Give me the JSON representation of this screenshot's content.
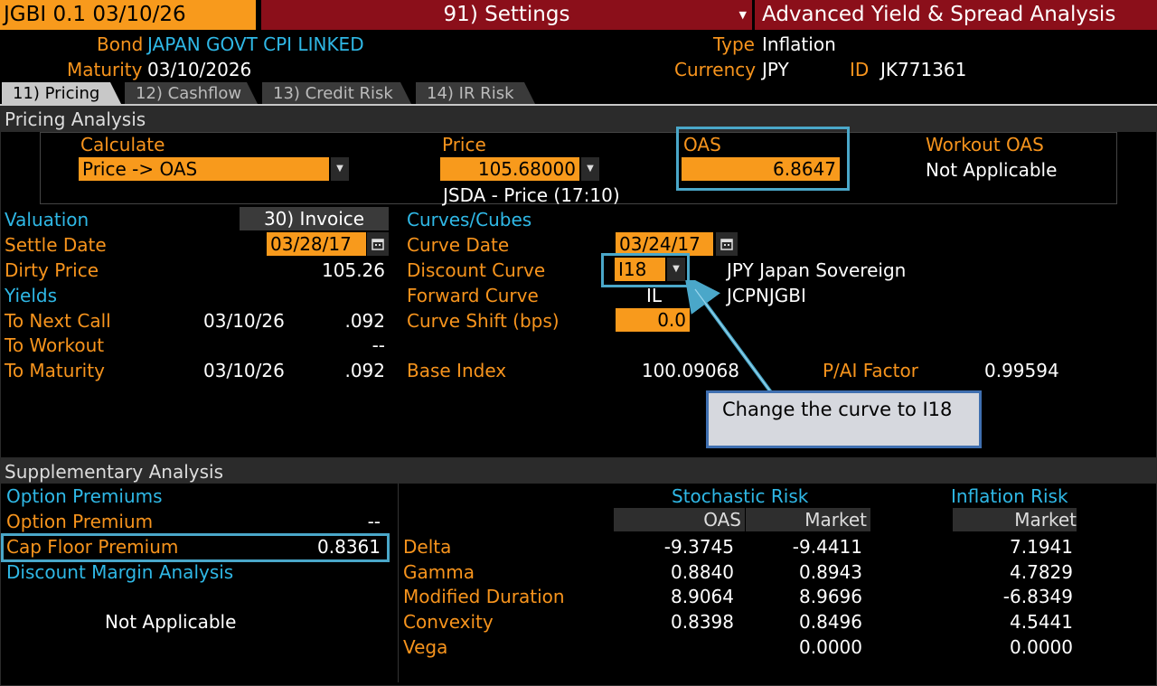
{
  "topbar": {
    "ticker": "JGBI 0.1 03/10/26",
    "settings": "91) Settings",
    "title": "Advanced Yield & Spread Analysis"
  },
  "bond_info": {
    "bond_label": "Bond",
    "bond_value": "JAPAN GOVT CPI LINKED",
    "maturity_label": "Maturity",
    "maturity_value": "03/10/2026",
    "type_label": "Type",
    "type_value": "Inflation",
    "currency_label": "Currency",
    "currency_value": "JPY",
    "id_label": "ID",
    "id_value": "JK771361"
  },
  "tabs": [
    {
      "label": "11) Pricing",
      "active": true
    },
    {
      "label": "12) Cashflow",
      "active": false
    },
    {
      "label": "13) Credit Risk",
      "active": false
    },
    {
      "label": "14) IR Risk",
      "active": false
    }
  ],
  "pricing": {
    "header": "Pricing Analysis",
    "calculate_label": "Calculate",
    "calculate_value": "Price -> OAS",
    "price_label": "Price",
    "price_value": "105.68000",
    "price_source": "JSDA - Price (17:10)",
    "oas_label": "OAS",
    "oas_value": "6.8647",
    "workout_label": "Workout OAS",
    "workout_value": "Not Applicable"
  },
  "valuation": {
    "label": "Valuation",
    "invoice_button": "30) Invoice",
    "settle_label": "Settle Date",
    "settle_value": "03/28/17",
    "dirty_label": "Dirty Price",
    "dirty_value": "105.26",
    "yields_label": "Yields",
    "next_call_label": "To Next Call",
    "next_call_date": "03/10/26",
    "next_call_value": ".092",
    "workout_label": "To Workout",
    "workout_value": "--",
    "maturity_label": "To Maturity",
    "maturity_date": "03/10/26",
    "maturity_value": ".092"
  },
  "curves": {
    "label": "Curves/Cubes",
    "curve_date_label": "Curve Date",
    "curve_date_value": "03/24/17",
    "discount_label": "Discount Curve",
    "discount_value": "I18",
    "discount_desc": "JPY Japan Sovereign",
    "forward_label": "Forward Curve",
    "forward_value": "IL",
    "forward_desc": "JCPNJGBI",
    "shift_label": "Curve Shift (bps)",
    "shift_value": "0.0",
    "base_index_label": "Base Index",
    "base_index_value": "100.09068",
    "pai_label": "P/AI Factor",
    "pai_value": "0.99594"
  },
  "callout": {
    "text": "Change the curve to I18"
  },
  "supplementary": {
    "header": "Supplementary Analysis",
    "option_premiums_label": "Option Premiums",
    "option_premium_label": "Option Premium",
    "option_premium_value": "--",
    "cap_floor_label": "Cap Floor Premium",
    "cap_floor_value": "0.8361",
    "dma_label": "Discount Margin Analysis",
    "dma_value": "Not Applicable",
    "stochastic_label": "Stochastic Risk",
    "inflation_label": "Inflation Risk",
    "col_oas": "OAS",
    "col_market": "Market",
    "col_inf_market": "Market",
    "rows": [
      {
        "label": "Delta",
        "oas": "-9.3745",
        "market": "-9.4411",
        "inflation": "7.1941"
      },
      {
        "label": "Gamma",
        "oas": "0.8840",
        "market": "0.8943",
        "inflation": "4.7829"
      },
      {
        "label": "Modified Duration",
        "oas": "8.9064",
        "market": "8.9696",
        "inflation": "-6.8349"
      },
      {
        "label": "Convexity",
        "oas": "0.8398",
        "market": "0.8496",
        "inflation": "4.5441"
      },
      {
        "label": "Vega",
        "oas": "",
        "market": "0.0000",
        "inflation": "0.0000"
      }
    ]
  }
}
